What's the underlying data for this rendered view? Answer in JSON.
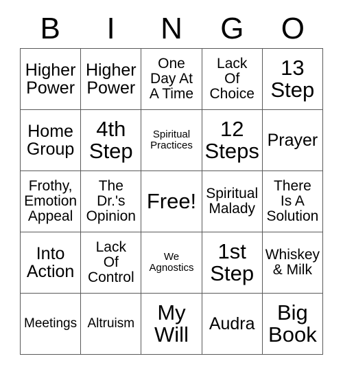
{
  "card": {
    "header": {
      "letters": [
        "B",
        "I",
        "N",
        "G",
        "O"
      ]
    },
    "colors": {
      "background": "#ffffff",
      "grid_line": "#595959",
      "text": "#000000"
    },
    "grid": {
      "columns": 5,
      "rows": 5,
      "cells": [
        {
          "text": "Higher\nPower",
          "size": "lg"
        },
        {
          "text": "Higher\nPower",
          "size": "lg"
        },
        {
          "text": "One\nDay At\nA Time",
          "size": "md"
        },
        {
          "text": "Lack\nOf\nChoice",
          "size": "md"
        },
        {
          "text": "13\nStep",
          "size": "xl"
        },
        {
          "text": "Home\nGroup",
          "size": "lg"
        },
        {
          "text": "4th\nStep",
          "size": "xl"
        },
        {
          "text": "Spiritual\nPractices",
          "size": "xs"
        },
        {
          "text": "12\nSteps",
          "size": "xl"
        },
        {
          "text": "Prayer",
          "size": "lg"
        },
        {
          "text": "Frothy,\nEmotion\nAppeal",
          "size": "md"
        },
        {
          "text": "The\nDr.'s\nOpinion",
          "size": "md"
        },
        {
          "text": "Free!",
          "size": "xl"
        },
        {
          "text": "Spiritual\nMalady",
          "size": "md"
        },
        {
          "text": "There\nIs A\nSolution",
          "size": "md"
        },
        {
          "text": "Into\nAction",
          "size": "lg"
        },
        {
          "text": "Lack\nOf\nControl",
          "size": "md"
        },
        {
          "text": "We\nAgnostics",
          "size": "xs"
        },
        {
          "text": "1st\nStep",
          "size": "xl"
        },
        {
          "text": "Whiskey\n& Milk",
          "size": "md"
        },
        {
          "text": "Meetings",
          "size": "sm"
        },
        {
          "text": "Altruism",
          "size": "sm"
        },
        {
          "text": "My\nWill",
          "size": "xl"
        },
        {
          "text": "Audra",
          "size": "lg"
        },
        {
          "text": "Big\nBook",
          "size": "xl"
        }
      ]
    }
  }
}
